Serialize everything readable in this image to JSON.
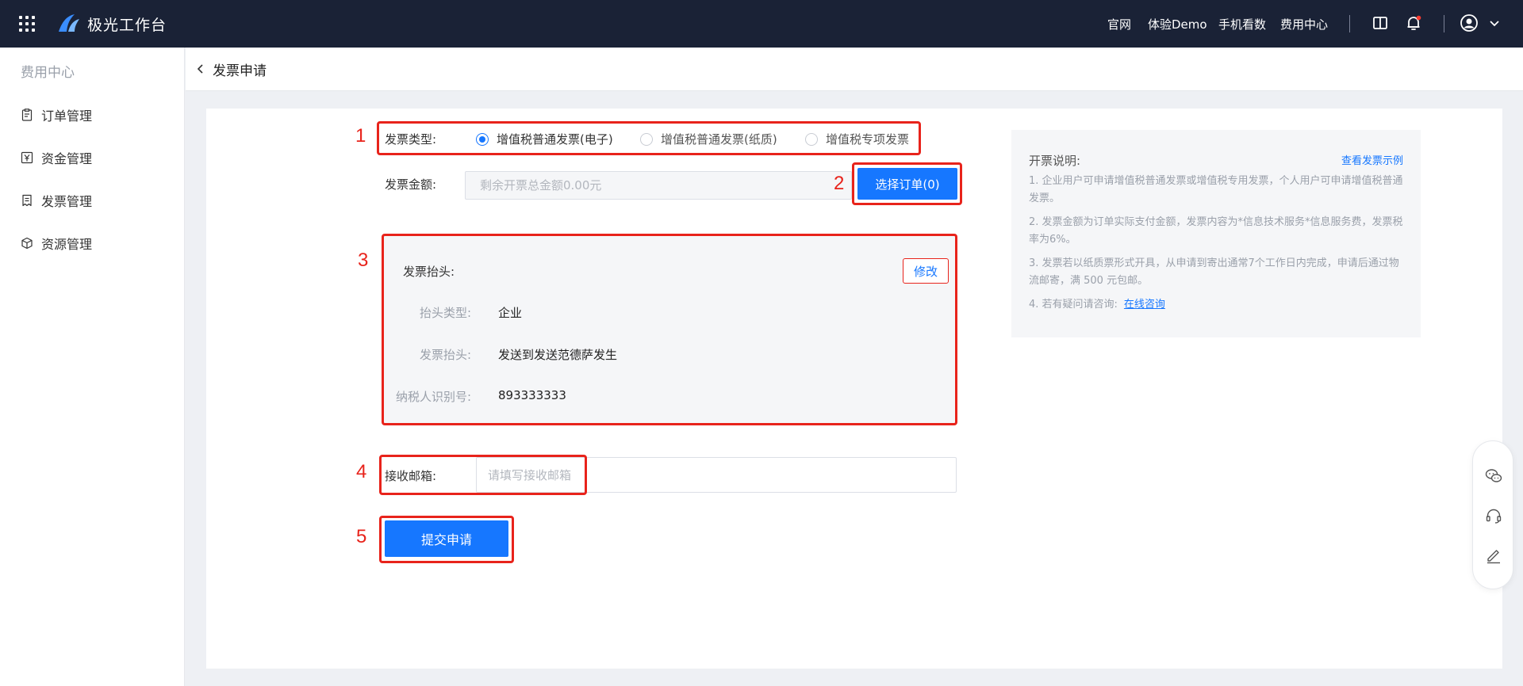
{
  "topbar": {
    "app_title": "极光工作台",
    "nav": [
      "官网",
      "体验Demo",
      "手机看数",
      "费用中心"
    ]
  },
  "sidebar": {
    "title": "费用中心",
    "items": [
      {
        "label": "订单管理",
        "icon": "clipboard-icon"
      },
      {
        "label": "资金管理",
        "icon": "yen-icon"
      },
      {
        "label": "发票管理",
        "icon": "receipt-icon"
      },
      {
        "label": "资源管理",
        "icon": "cube-icon"
      }
    ]
  },
  "header": {
    "title": "发票申请"
  },
  "annotations": [
    "1",
    "2",
    "3",
    "4",
    "5"
  ],
  "form": {
    "type_label": "发票类型:",
    "type_options": [
      "增值税普通发票(电子)",
      "增值税普通发票(纸质)",
      "增值税专项发票"
    ],
    "type_selected": "增值税普通发票(电子)",
    "amount_label": "发票金额:",
    "amount_placeholder": "剩余开票总金额0.00元",
    "select_order_label": "选择订单(0)",
    "title_panel": {
      "heading": "发票抬头:",
      "edit_label": "修改",
      "rows": [
        {
          "label": "抬头类型:",
          "value": "企业"
        },
        {
          "label": "发票抬头:",
          "value": "发送到发送范德萨发生"
        },
        {
          "label": "纳税人识别号:",
          "value": "893333333"
        }
      ]
    },
    "email_label": "接收邮箱:",
    "email_placeholder": "请填写接收邮箱",
    "submit_label": "提交申请"
  },
  "notes": {
    "title": "开票说明:",
    "example_link": "查看发票示例",
    "items": [
      "1. 企业用户可申请增值税普通发票或增值税专用发票，个人用户可申请增值税普通发票。",
      "2. 发票金额为订单实际支付金额，发票内容为*信息技术服务*信息服务费，发票税率为6%。",
      "3. 发票若以纸质票形式开具，从申请到寄出通常7个工作日内完成，申请后通过物流邮寄，满 500 元包邮。",
      "4. 若有疑问请咨询:"
    ],
    "consult_link": "在线咨询"
  },
  "colors": {
    "topbar_bg": "#1a2236",
    "accent": "#1677ff",
    "annotation_red": "#e8231b"
  }
}
